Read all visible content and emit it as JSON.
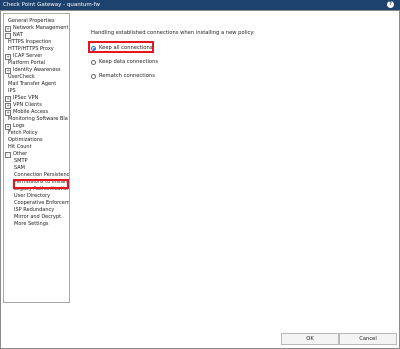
{
  "window": {
    "title": "Check Point Gateway - quantum-fw",
    "help_icon": "?"
  },
  "tree": {
    "items": [
      {
        "label": "General Properties",
        "expander": ""
      },
      {
        "label": "Network Management",
        "expander": "+"
      },
      {
        "label": "NAT",
        "expander": "-"
      },
      {
        "label": "HTTPS Inspection",
        "expander": ""
      },
      {
        "label": "HTTP/HTTPS Proxy",
        "expander": ""
      },
      {
        "label": "ICAP Server",
        "expander": "+"
      },
      {
        "label": "Platform Portal",
        "expander": ""
      },
      {
        "label": "Identity Awareness",
        "expander": "+"
      },
      {
        "label": "UserCheck",
        "expander": ""
      },
      {
        "label": "Mail Transfer Agent",
        "expander": ""
      },
      {
        "label": "IPS",
        "expander": ""
      },
      {
        "label": "IPSec VPN",
        "expander": "+"
      },
      {
        "label": "VPN Clients",
        "expander": "+"
      },
      {
        "label": "Mobile Access",
        "expander": "+"
      },
      {
        "label": "Monitoring Software Bla",
        "expander": ""
      },
      {
        "label": "Logs",
        "expander": "+"
      },
      {
        "label": "Fetch Policy",
        "expander": ""
      },
      {
        "label": "Optimizations",
        "expander": ""
      },
      {
        "label": "Hit Count",
        "expander": ""
      },
      {
        "label": "Other",
        "expander": "-"
      },
      {
        "label": "SMTP",
        "expander": ""
      },
      {
        "label": "SAM",
        "expander": ""
      },
      {
        "label": "Connection Persistenc",
        "expander": ""
      },
      {
        "label": "Permissions to Install",
        "expander": ""
      },
      {
        "label": "Legacy Authenticatior",
        "expander": ""
      },
      {
        "label": "User Directory",
        "expander": ""
      },
      {
        "label": "Cooperative Enforcem",
        "expander": ""
      },
      {
        "label": "ISP Redundancy",
        "expander": ""
      },
      {
        "label": "Mirror and Decrypt",
        "expander": ""
      },
      {
        "label": "More Settings",
        "expander": ""
      }
    ]
  },
  "content": {
    "heading": "Handling established connections when installing a new policy:",
    "options": [
      {
        "label": "Keep all connections",
        "selected": true
      },
      {
        "label": "Keep data connections",
        "selected": false
      },
      {
        "label": "Rematch connections",
        "selected": false
      }
    ]
  },
  "buttons": {
    "ok": "OK",
    "cancel": "Cancel"
  },
  "colors": {
    "titlebar": "#1d426e",
    "highlight": "#e8141f",
    "radio_selected": "#1f6dc4"
  }
}
